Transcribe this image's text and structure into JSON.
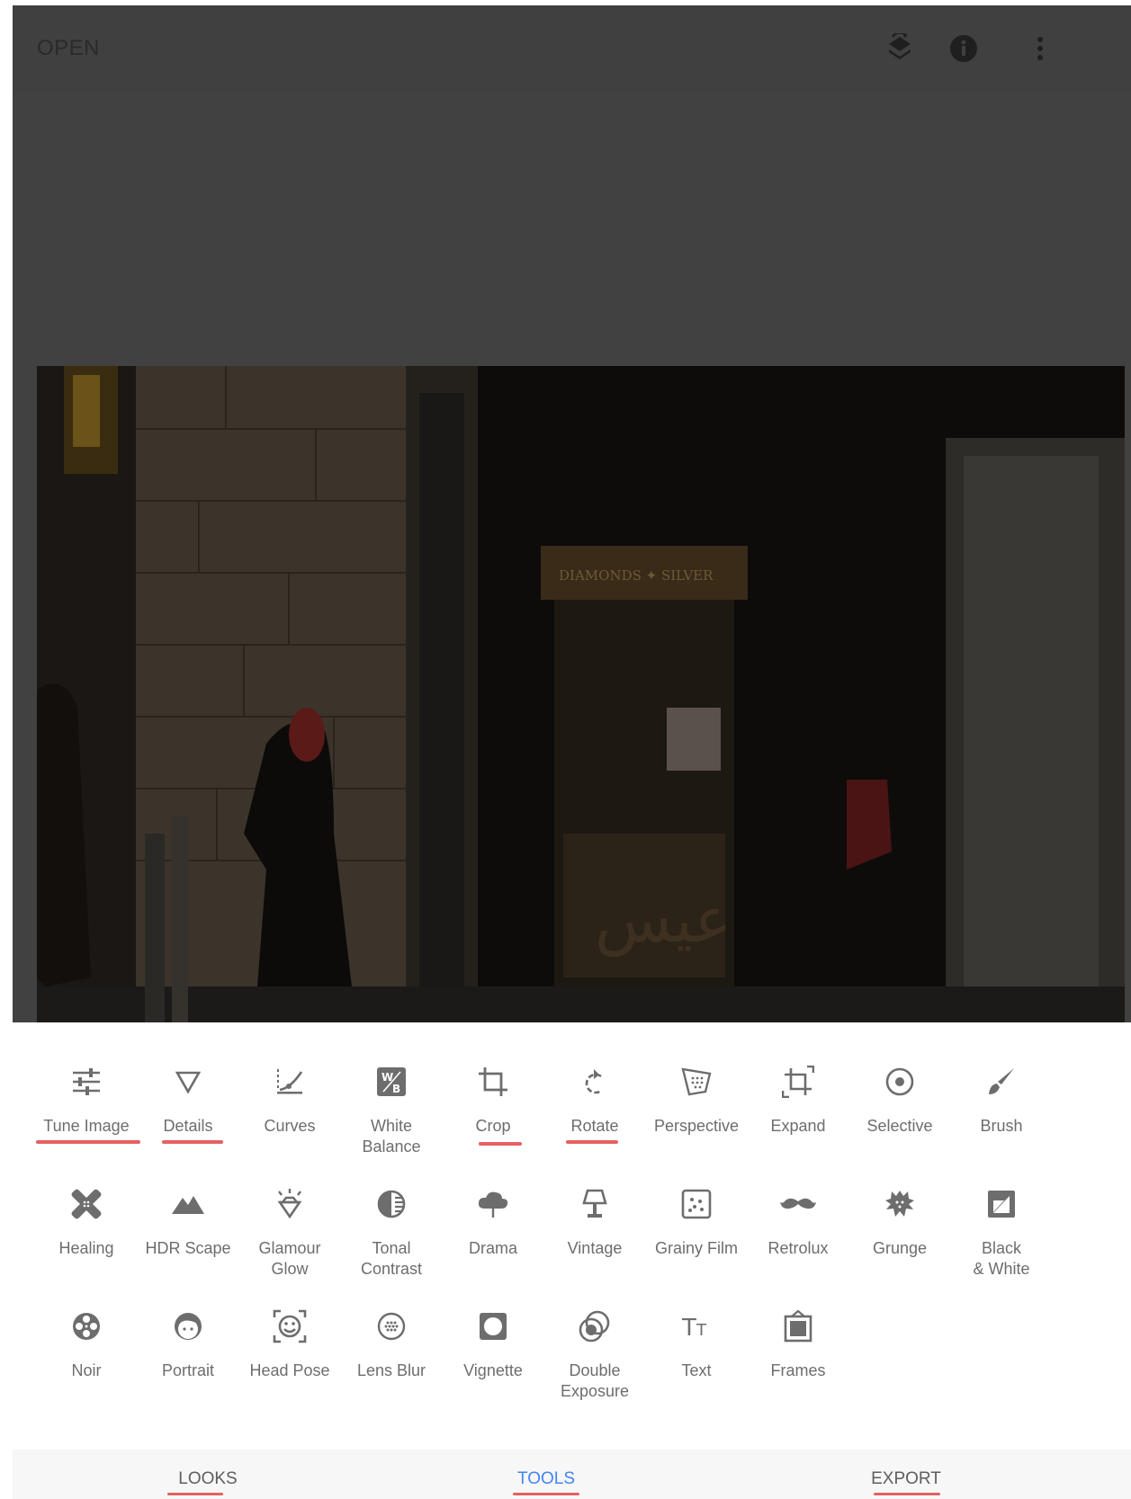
{
  "topbar": {
    "open_label": "OPEN",
    "icons": [
      "layers-undo-icon",
      "info-icon",
      "more-vert-icon"
    ]
  },
  "photo": {
    "sign_text": "DIAMONDS ✦ SILVER",
    "shop_script": "عيس"
  },
  "tools": [
    {
      "label": "Tune Image",
      "icon": "tune-icon"
    },
    {
      "label": "Details",
      "icon": "triangle-icon"
    },
    {
      "label": "Curves",
      "icon": "curves-icon"
    },
    {
      "label": "White\nBalance",
      "icon": "white-balance-icon"
    },
    {
      "label": "Crop",
      "icon": "crop-icon"
    },
    {
      "label": "Rotate",
      "icon": "rotate-icon"
    },
    {
      "label": "Perspective",
      "icon": "perspective-icon"
    },
    {
      "label": "Expand",
      "icon": "expand-icon"
    },
    {
      "label": "Selective",
      "icon": "selective-icon"
    },
    {
      "label": "Brush",
      "icon": "brush-icon"
    },
    {
      "label": "Healing",
      "icon": "healing-icon"
    },
    {
      "label": "HDR Scape",
      "icon": "mountain-icon"
    },
    {
      "label": "Glamour\nGlow",
      "icon": "diamond-icon"
    },
    {
      "label": "Tonal\nContrast",
      "icon": "tonal-icon"
    },
    {
      "label": "Drama",
      "icon": "cloud-icon"
    },
    {
      "label": "Vintage",
      "icon": "lamp-icon"
    },
    {
      "label": "Grainy Film",
      "icon": "film-grain-icon"
    },
    {
      "label": "Retrolux",
      "icon": "mustache-icon"
    },
    {
      "label": "Grunge",
      "icon": "grunge-icon"
    },
    {
      "label": "Black\n& White",
      "icon": "bw-icon"
    },
    {
      "label": "Noir",
      "icon": "film-reel-icon"
    },
    {
      "label": "Portrait",
      "icon": "face-icon"
    },
    {
      "label": "Head Pose",
      "icon": "head-pose-icon"
    },
    {
      "label": "Lens Blur",
      "icon": "lens-blur-icon"
    },
    {
      "label": "Vignette",
      "icon": "vignette-icon"
    },
    {
      "label": "Double\nExposure",
      "icon": "double-exposure-icon"
    },
    {
      "label": "Text",
      "icon": "text-icon"
    },
    {
      "label": "Frames",
      "icon": "frames-icon"
    }
  ],
  "nav": {
    "looks": "LOOKS",
    "tools": "TOOLS",
    "export": "EXPORT",
    "active_color": "#4285f4"
  },
  "colors": {
    "topbar_bg": "#404040",
    "canvas_bg": "#414141",
    "icon_grey": "#6d6d6d",
    "annotation_red": "#e04545"
  }
}
